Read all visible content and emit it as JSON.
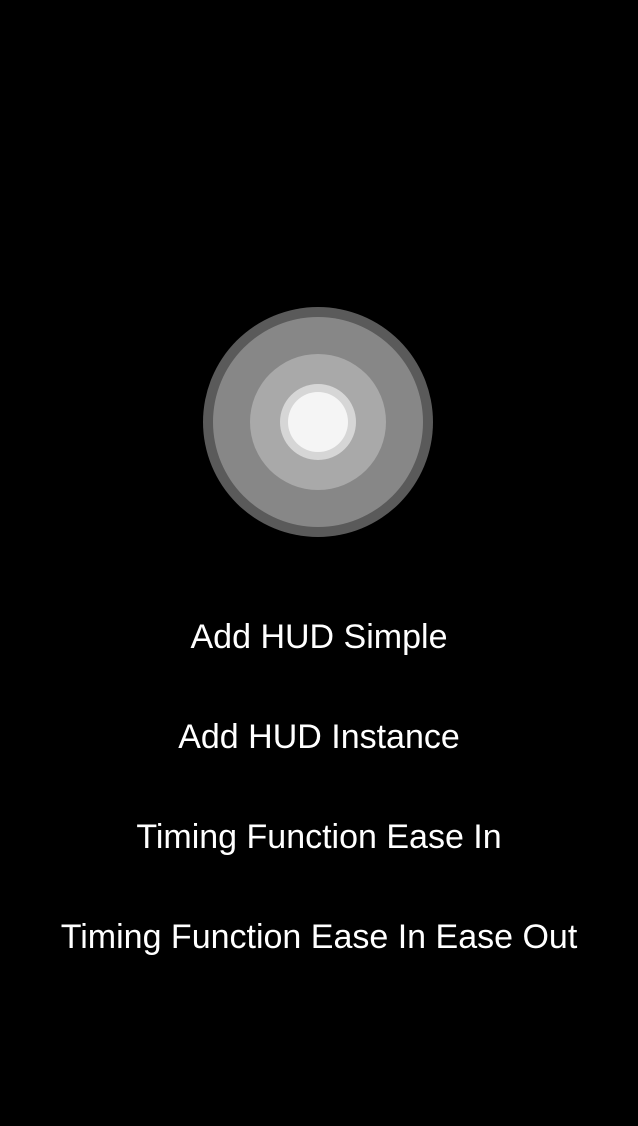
{
  "colors": {
    "background": "#000000",
    "text": "#ffffff",
    "hud_outer": "#5a5a5a",
    "hud_mid": "#878787",
    "hud_inner": "#a9a9a9",
    "hud_glow": "#d6d6d6",
    "hud_core": "#f5f5f5"
  },
  "hud": {
    "icon": "hud-spinner-icon"
  },
  "buttons": [
    {
      "label": "Add HUD Simple"
    },
    {
      "label": "Add HUD Instance"
    },
    {
      "label": "Timing Function Ease In"
    },
    {
      "label": "Timing Function Ease In Ease Out"
    }
  ]
}
